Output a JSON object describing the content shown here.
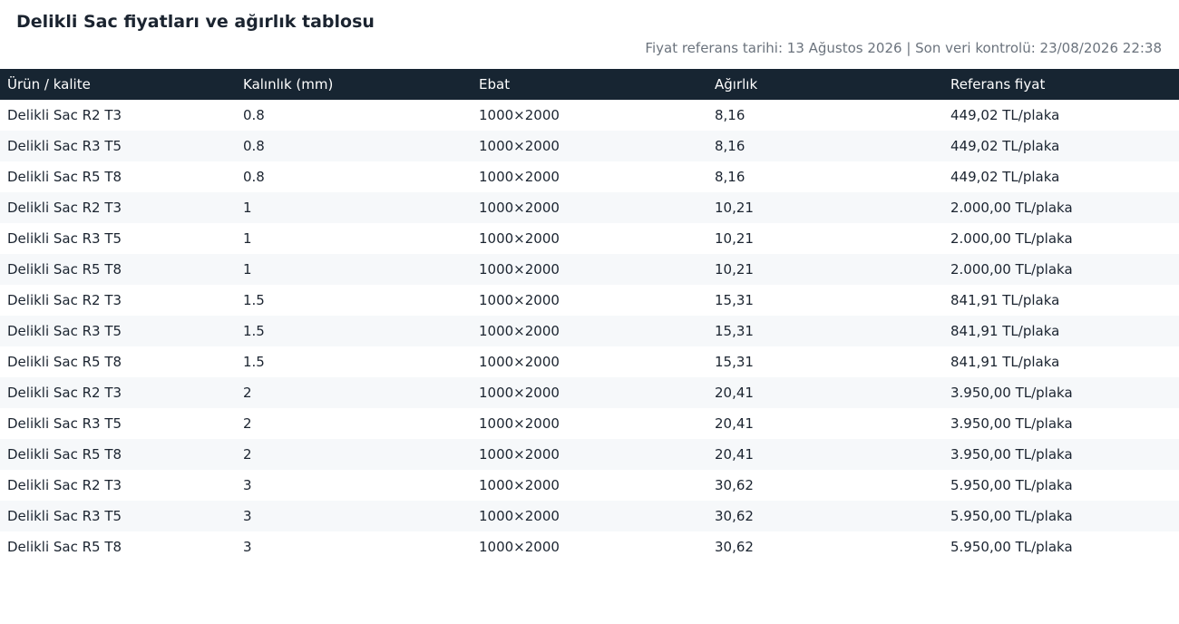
{
  "page": {
    "title": "Delikli Sac fiyatları ve ağırlık tablosu",
    "meta": "Fiyat referans tarihi: 13 Ağustos 2026 | Son veri kontrolü: 23/08/2026 22:38"
  },
  "table": {
    "columns": [
      "Ürün / kalite",
      "Kalınlık (mm)",
      "Ebat",
      "Ağırlık",
      "Referans fiyat"
    ],
    "rows": [
      [
        "Delikli Sac R2 T3",
        "0.8",
        "1000×2000",
        "8,16",
        "449,02 TL/plaka"
      ],
      [
        "Delikli Sac R3 T5",
        "0.8",
        "1000×2000",
        "8,16",
        "449,02 TL/plaka"
      ],
      [
        "Delikli Sac R5 T8",
        "0.8",
        "1000×2000",
        "8,16",
        "449,02 TL/plaka"
      ],
      [
        "Delikli Sac R2 T3",
        "1",
        "1000×2000",
        "10,21",
        "2.000,00 TL/plaka"
      ],
      [
        "Delikli Sac R3 T5",
        "1",
        "1000×2000",
        "10,21",
        "2.000,00 TL/plaka"
      ],
      [
        "Delikli Sac R5 T8",
        "1",
        "1000×2000",
        "10,21",
        "2.000,00 TL/plaka"
      ],
      [
        "Delikli Sac R2 T3",
        "1.5",
        "1000×2000",
        "15,31",
        "841,91 TL/plaka"
      ],
      [
        "Delikli Sac R3 T5",
        "1.5",
        "1000×2000",
        "15,31",
        "841,91 TL/plaka"
      ],
      [
        "Delikli Sac R5 T8",
        "1.5",
        "1000×2000",
        "15,31",
        "841,91 TL/plaka"
      ],
      [
        "Delikli Sac R2 T3",
        "2",
        "1000×2000",
        "20,41",
        "3.950,00 TL/plaka"
      ],
      [
        "Delikli Sac R3 T5",
        "2",
        "1000×2000",
        "20,41",
        "3.950,00 TL/plaka"
      ],
      [
        "Delikli Sac R5 T8",
        "2",
        "1000×2000",
        "20,41",
        "3.950,00 TL/plaka"
      ],
      [
        "Delikli Sac R2 T3",
        "3",
        "1000×2000",
        "30,62",
        "5.950,00 TL/plaka"
      ],
      [
        "Delikli Sac R3 T5",
        "3",
        "1000×2000",
        "30,62",
        "5.950,00 TL/plaka"
      ],
      [
        "Delikli Sac R5 T8",
        "3",
        "1000×2000",
        "30,62",
        "5.950,00 TL/plaka"
      ]
    ]
  },
  "colors": {
    "header_bg": "#172532",
    "header_text": "#ffffff",
    "row_alt_bg": "#f6f8fa",
    "meta_text": "#6b737d"
  }
}
